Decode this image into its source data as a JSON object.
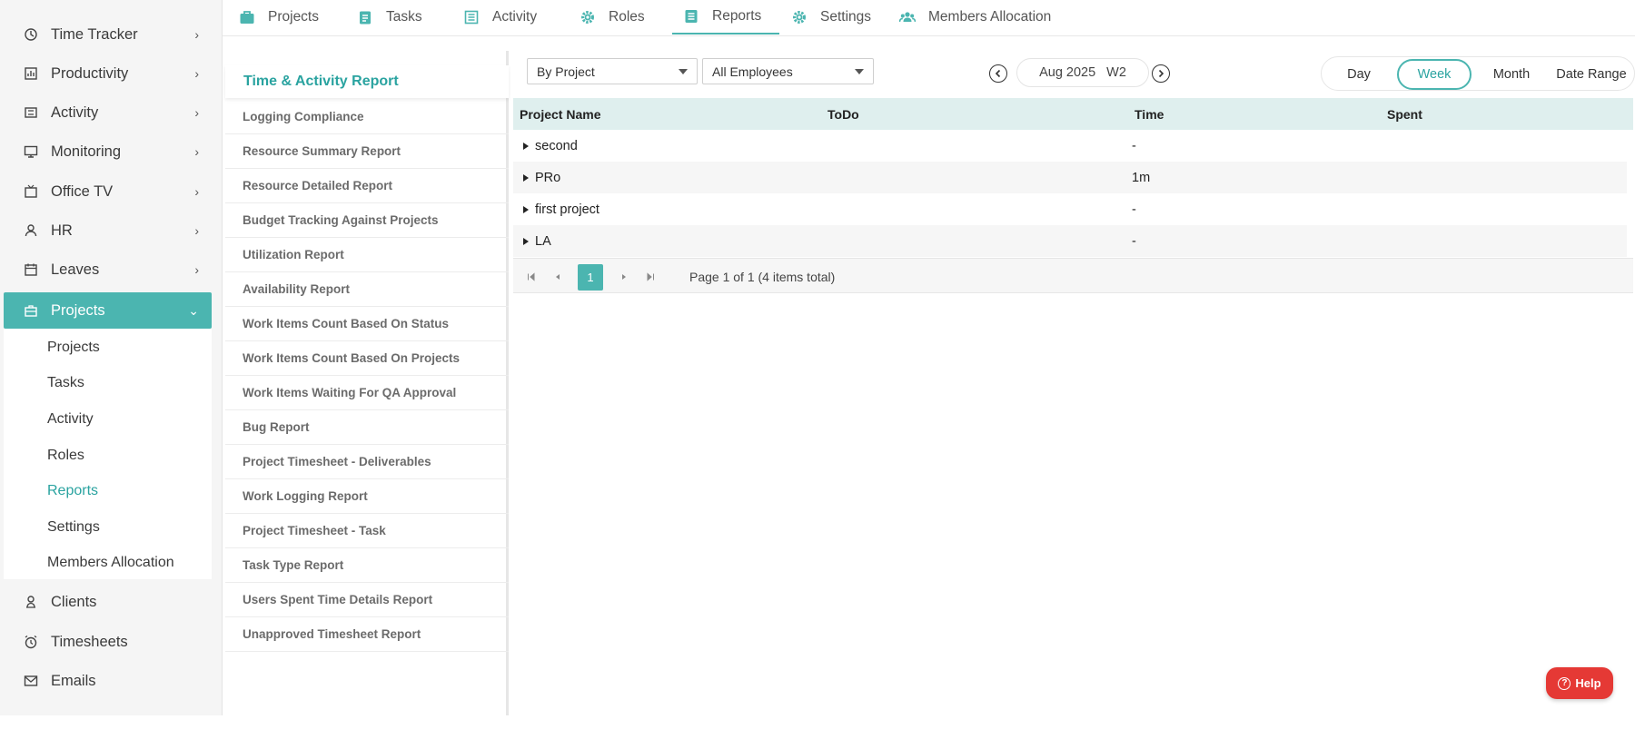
{
  "sidebar": {
    "items": [
      {
        "label": "Time Tracker",
        "icon": "timer-icon"
      },
      {
        "label": "Productivity",
        "icon": "chart-icon"
      },
      {
        "label": "Activity",
        "icon": "ticket-icon"
      },
      {
        "label": "Monitoring",
        "icon": "monitor-icon"
      },
      {
        "label": "Office TV",
        "icon": "tv-icon"
      },
      {
        "label": "HR",
        "icon": "person-icon"
      },
      {
        "label": "Leaves",
        "icon": "calendar-icon"
      },
      {
        "label": "Projects",
        "icon": "briefcase-icon"
      },
      {
        "label": "Clients",
        "icon": "client-icon"
      },
      {
        "label": "Timesheets",
        "icon": "alarm-icon"
      },
      {
        "label": "Emails",
        "icon": "mail-icon"
      }
    ],
    "active_item": "Projects",
    "projects_submenu": [
      "Projects",
      "Tasks",
      "Activity",
      "Roles",
      "Reports",
      "Settings",
      "Members Allocation"
    ],
    "active_subitem": "Reports"
  },
  "tabs": [
    {
      "label": "Projects",
      "icon": "briefcase-icon"
    },
    {
      "label": "Tasks",
      "icon": "clipboard-icon"
    },
    {
      "label": "Activity",
      "icon": "list-icon"
    },
    {
      "label": "Roles",
      "icon": "gear-icon"
    },
    {
      "label": "Reports",
      "icon": "report-icon"
    },
    {
      "label": "Settings",
      "icon": "gear-icon"
    },
    {
      "label": "Members Allocation",
      "icon": "users-icon"
    }
  ],
  "active_tab": "Reports",
  "reports": {
    "title": "Time & Activity Report",
    "items": [
      "Logging Compliance",
      "Resource Summary Report",
      "Resource Detailed Report",
      "Budget Tracking Against Projects",
      "Utilization Report",
      "Availability Report",
      "Work Items Count Based On Status",
      "Work Items Count Based On Projects",
      "Work Items Waiting For QA Approval",
      "Bug Report",
      "Project Timesheet - Deliverables",
      "Work Logging Report",
      "Project Timesheet - Task",
      "Task Type Report",
      "Users Spent Time Details Report",
      "Unapproved Timesheet Report"
    ]
  },
  "filters": {
    "group_by": "By Project",
    "employees": "All Employees",
    "period": "Aug 2025",
    "week": "W2",
    "modes": [
      "Day",
      "Week",
      "Month",
      "Date Range"
    ],
    "active_mode": "Week"
  },
  "grid": {
    "columns": [
      "Project Name",
      "ToDo",
      "Time",
      "Spent"
    ],
    "rows": [
      {
        "name": "second",
        "time": "-"
      },
      {
        "name": "PRo",
        "time": "1m"
      },
      {
        "name": "first project",
        "time": "-"
      },
      {
        "name": "LA",
        "time": "-"
      }
    ]
  },
  "pager": {
    "current_page": "1",
    "info": "Page 1 of 1 (4 items total)"
  },
  "help_label": "Help",
  "colors": {
    "accent": "#4bb5b0",
    "accent_text": "#2aa3a0",
    "help": "#e53935",
    "header_bg": "#dfefee"
  }
}
